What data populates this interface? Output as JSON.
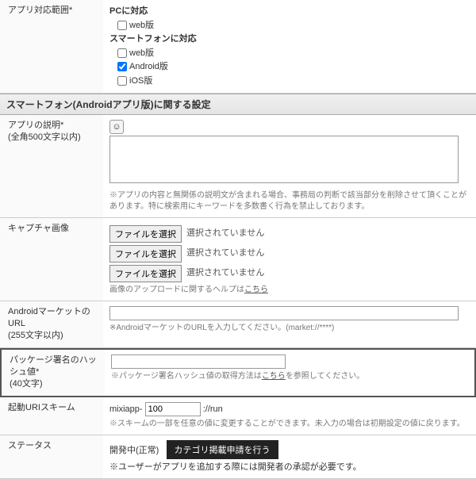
{
  "row_support": {
    "label": "アプリ対応範囲*",
    "pc_heading": "PCに対応",
    "pc_web": "web版",
    "sp_heading": "スマートフォンに対応",
    "sp_web": "web版",
    "sp_android": "Android版",
    "sp_ios": "iOS版"
  },
  "section_header": "スマートフォン(Androidアプリ版)に関する設定",
  "row_desc": {
    "label": "アプリの説明*",
    "label_sub": "(全角500文字以内)",
    "note": "※アプリの内容と無関係の説明文が含まれる場合、事務局の判断で該当部分を削除させて頂くことがあります。特に検索用にキーワードを多数書く行為を禁止しております。"
  },
  "row_capture": {
    "label": "キャプチャ画像",
    "btn": "ファイルを選択",
    "status": "選択されていません",
    "help_prefix": "画像のアップロードに関するヘルプは",
    "help_link": "こちら"
  },
  "row_market": {
    "label": "AndroidマーケットのURL",
    "label_sub": "(255文字以内)",
    "note": "※AndroidマーケットのURLを入力してください。(market://****)"
  },
  "row_hash": {
    "label": "パッケージ署名のハッシュ値*",
    "label_sub": "(40文字)",
    "note_prefix": "※パッケージ署名ハッシュ値の取得方法は",
    "note_link": "こちら",
    "note_suffix": "を参照してください。"
  },
  "row_uri": {
    "label": "起動URIスキーム",
    "prefix": "mixiapp-",
    "value": "100",
    "suffix": "://run",
    "note": "※スキームの一部を任意の値に変更することができます。未入力の場合は初期設定の値に戻ります。"
  },
  "row_status": {
    "label": "ステータス",
    "value": "開発中(正常)",
    "button": "カテゴリ掲載申請を行う",
    "note": "※ユーザーがアプリを追加する際には開発者の承認が必要です。"
  }
}
